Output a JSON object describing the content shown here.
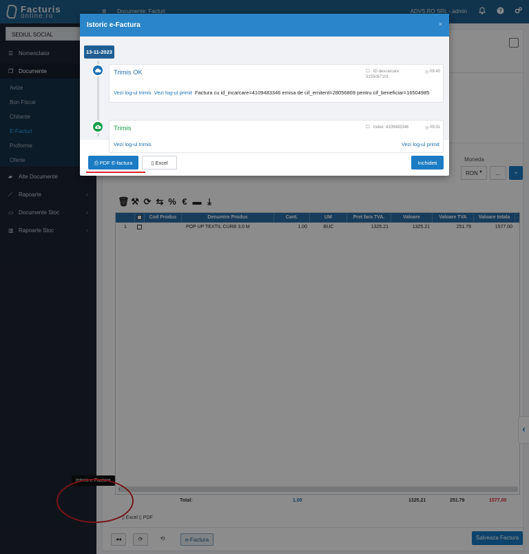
{
  "topbar": {
    "logo_line1": "Facturis",
    "logo_line2": "online.ro",
    "breadcrumb": "Documente: Facturi",
    "company": "ADVS.RO SRL - admin"
  },
  "sidebar": {
    "sediu": "SEDIUL SOCIAL",
    "items": [
      {
        "label": "Nomenclator"
      },
      {
        "label": "Documente"
      },
      {
        "label": "Alte Documente"
      },
      {
        "label": "Rapoarte"
      },
      {
        "label": "Documente Stoc"
      },
      {
        "label": "Rapoarte Stoc"
      }
    ],
    "sub_items": [
      "Avize",
      "Bon Fiscal",
      "Chitante",
      "E-Facturi",
      "Proforme",
      "Oferte"
    ]
  },
  "form": {
    "moneda_label": "Moneda",
    "moneda_value": "RON",
    "dots": "..."
  },
  "grid": {
    "headers": [
      "Cod Produs",
      "Denumire Produs",
      "Cant.",
      "UM",
      "Pret fara TVA.",
      "Valoare",
      "Valoare TVA",
      "Valoare totala"
    ],
    "rows": [
      {
        "nr": "1",
        "cod": "",
        "denumire": "POP UP TEXTIL CURB 3.0 M",
        "cant": "1.00",
        "um": "BUC",
        "pret": "1325.21",
        "valoare": "1325.21",
        "tva": "251.79",
        "total": "1577.00"
      }
    ],
    "totals": {
      "label": "Total:",
      "cant": "1.00",
      "valoare": "1325.21",
      "tva": "251.79",
      "total": "1577.00"
    },
    "export": {
      "excel": "Excel",
      "pdf": "PDF"
    }
  },
  "bottom": {
    "efactura_label": "e-Factura",
    "tooltip": "Istoric e-Factura",
    "save_label": "Salveaza Factura"
  },
  "modal": {
    "title": "Istoric e-Factura",
    "close_x": "×",
    "date": "13-11-2023",
    "entries": [
      {
        "title": "Trimis OK",
        "meta_label": "ID descarcare:",
        "meta_value": "3155067101",
        "time": "09:40",
        "link1": "Vezi log-ul trimis",
        "link2": "Vezi log-ul primit",
        "message": "Factura cu id_incarcare=4109483346 emisa de cif_emitent=28056869 pentru cif_beneficiar=16504985"
      },
      {
        "title": "Trimis",
        "meta_label": "Index: 4109483346",
        "time": "09:31",
        "link1": "Vezi log-ul trimis",
        "link2": "Vezi log-ul primit"
      }
    ],
    "pdf_label": "PDF E-factura",
    "excel_label": "Excel",
    "close_label": "Inchideti"
  },
  "colors": {
    "topbar": "#1f5f8c",
    "sidebar": "#1d2430",
    "accent": "#1b7cc4",
    "success": "#159c4a",
    "annotation_red": "#d8262c"
  }
}
